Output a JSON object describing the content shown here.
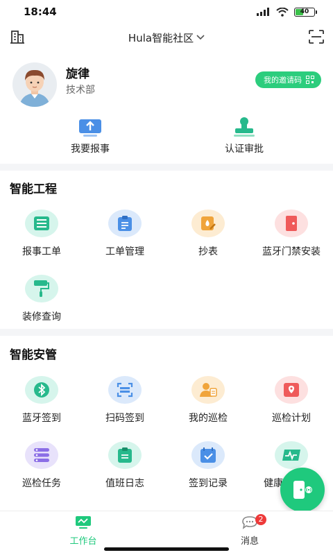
{
  "status_bar": {
    "time": "18:44",
    "battery": "40"
  },
  "header": {
    "community": "Hula智能社区"
  },
  "profile": {
    "name": "旋律",
    "department": "技术部",
    "invite_label": "我的邀请码"
  },
  "quick_actions": [
    {
      "label": "我要报事",
      "icon": "upload-report-icon"
    },
    {
      "label": "认证审批",
      "icon": "stamp-icon"
    }
  ],
  "sections": {
    "engineering": {
      "title": "智能工程",
      "items": [
        {
          "label": "报事工单",
          "icon": "form-list-icon",
          "bg": "#d6f5ec",
          "fg": "#27b98c"
        },
        {
          "label": "工单管理",
          "icon": "clipboard-list-icon",
          "bg": "#dbe9fb",
          "fg": "#4a8fe6"
        },
        {
          "label": "抄表",
          "icon": "meter-read-icon",
          "bg": "#fdecd2",
          "fg": "#f0a43a"
        },
        {
          "label": "蓝牙门禁安装",
          "icon": "door-icon",
          "bg": "#fde0e0",
          "fg": "#ef5a5a"
        },
        {
          "label": "装修查询",
          "icon": "paint-roller-icon",
          "bg": "#d6f5ec",
          "fg": "#27b98c"
        }
      ]
    },
    "security": {
      "title": "智能安管",
      "items": [
        {
          "label": "蓝牙签到",
          "icon": "bluetooth-icon",
          "bg": "#d6f5ec",
          "fg": "#27b98c"
        },
        {
          "label": "扫码签到",
          "icon": "scan-icon",
          "bg": "#dbe9fb",
          "fg": "#4a8fe6"
        },
        {
          "label": "我的巡检",
          "icon": "inspector-icon",
          "bg": "#fdecd2",
          "fg": "#f0a43a"
        },
        {
          "label": "巡检计划",
          "icon": "location-card-icon",
          "bg": "#fde0e0",
          "fg": "#ef5a5a"
        },
        {
          "label": "巡检任务",
          "icon": "task-stack-icon",
          "bg": "#e8e2fb",
          "fg": "#8b6ee6"
        },
        {
          "label": "值班日志",
          "icon": "duty-log-icon",
          "bg": "#d6f5ec",
          "fg": "#27b98c"
        },
        {
          "label": "签到记录",
          "icon": "checkin-record-icon",
          "bg": "#dbe9fb",
          "fg": "#4a8fe6"
        },
        {
          "label": "健康",
          "icon": "health-pulse-icon",
          "bg": "#d6f5ec",
          "fg": "#27b98c"
        }
      ]
    }
  },
  "tabbar": {
    "workbench": {
      "label": "工作台",
      "icon": "workbench-icon",
      "color": "#1fc97d"
    },
    "messages": {
      "label": "消息",
      "icon": "chat-bubble-icon",
      "badge": "2"
    }
  },
  "colors": {
    "accent": "#2ccd7d",
    "badge": "#ee3a3a"
  }
}
